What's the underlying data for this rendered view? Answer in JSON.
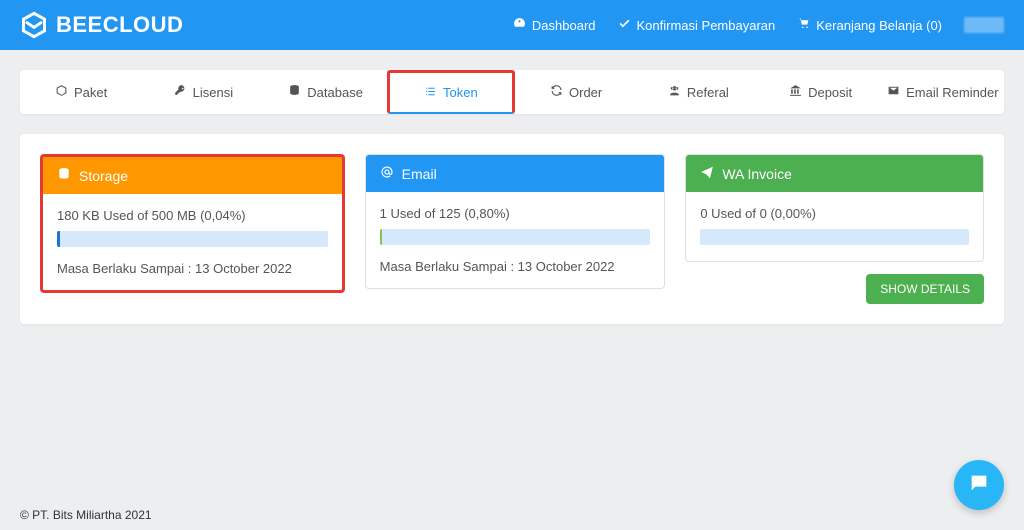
{
  "brand": {
    "name": "BEECLOUD"
  },
  "top_nav": {
    "dashboard": "Dashboard",
    "konfirmasi": "Konfirmasi Pembayaran",
    "keranjang": "Keranjang Belanja (0)"
  },
  "tabs": {
    "paket": "Paket",
    "lisensi": "Lisensi",
    "database": "Database",
    "token": "Token",
    "order": "Order",
    "referal": "Referal",
    "deposit": "Deposit",
    "email_reminder": "Email Reminder"
  },
  "panels": {
    "storage": {
      "title": "Storage",
      "usage_text": "180 KB Used of 500 MB (0,04%)",
      "progress_pct": 1,
      "expiry_text": "Masa Berlaku Sampai : 13 October 2022"
    },
    "email": {
      "title": "Email",
      "usage_text": "1 Used of 125 (0,80%)",
      "progress_pct": 1,
      "expiry_text": "Masa Berlaku Sampai : 13 October 2022"
    },
    "wa": {
      "title": "WA Invoice",
      "usage_text": "0 Used of 0 (0,00%)",
      "progress_pct": 0,
      "show_details": "SHOW DETAILS"
    }
  },
  "footer": {
    "copyright": "© PT. Bits Miliartha 2021"
  }
}
